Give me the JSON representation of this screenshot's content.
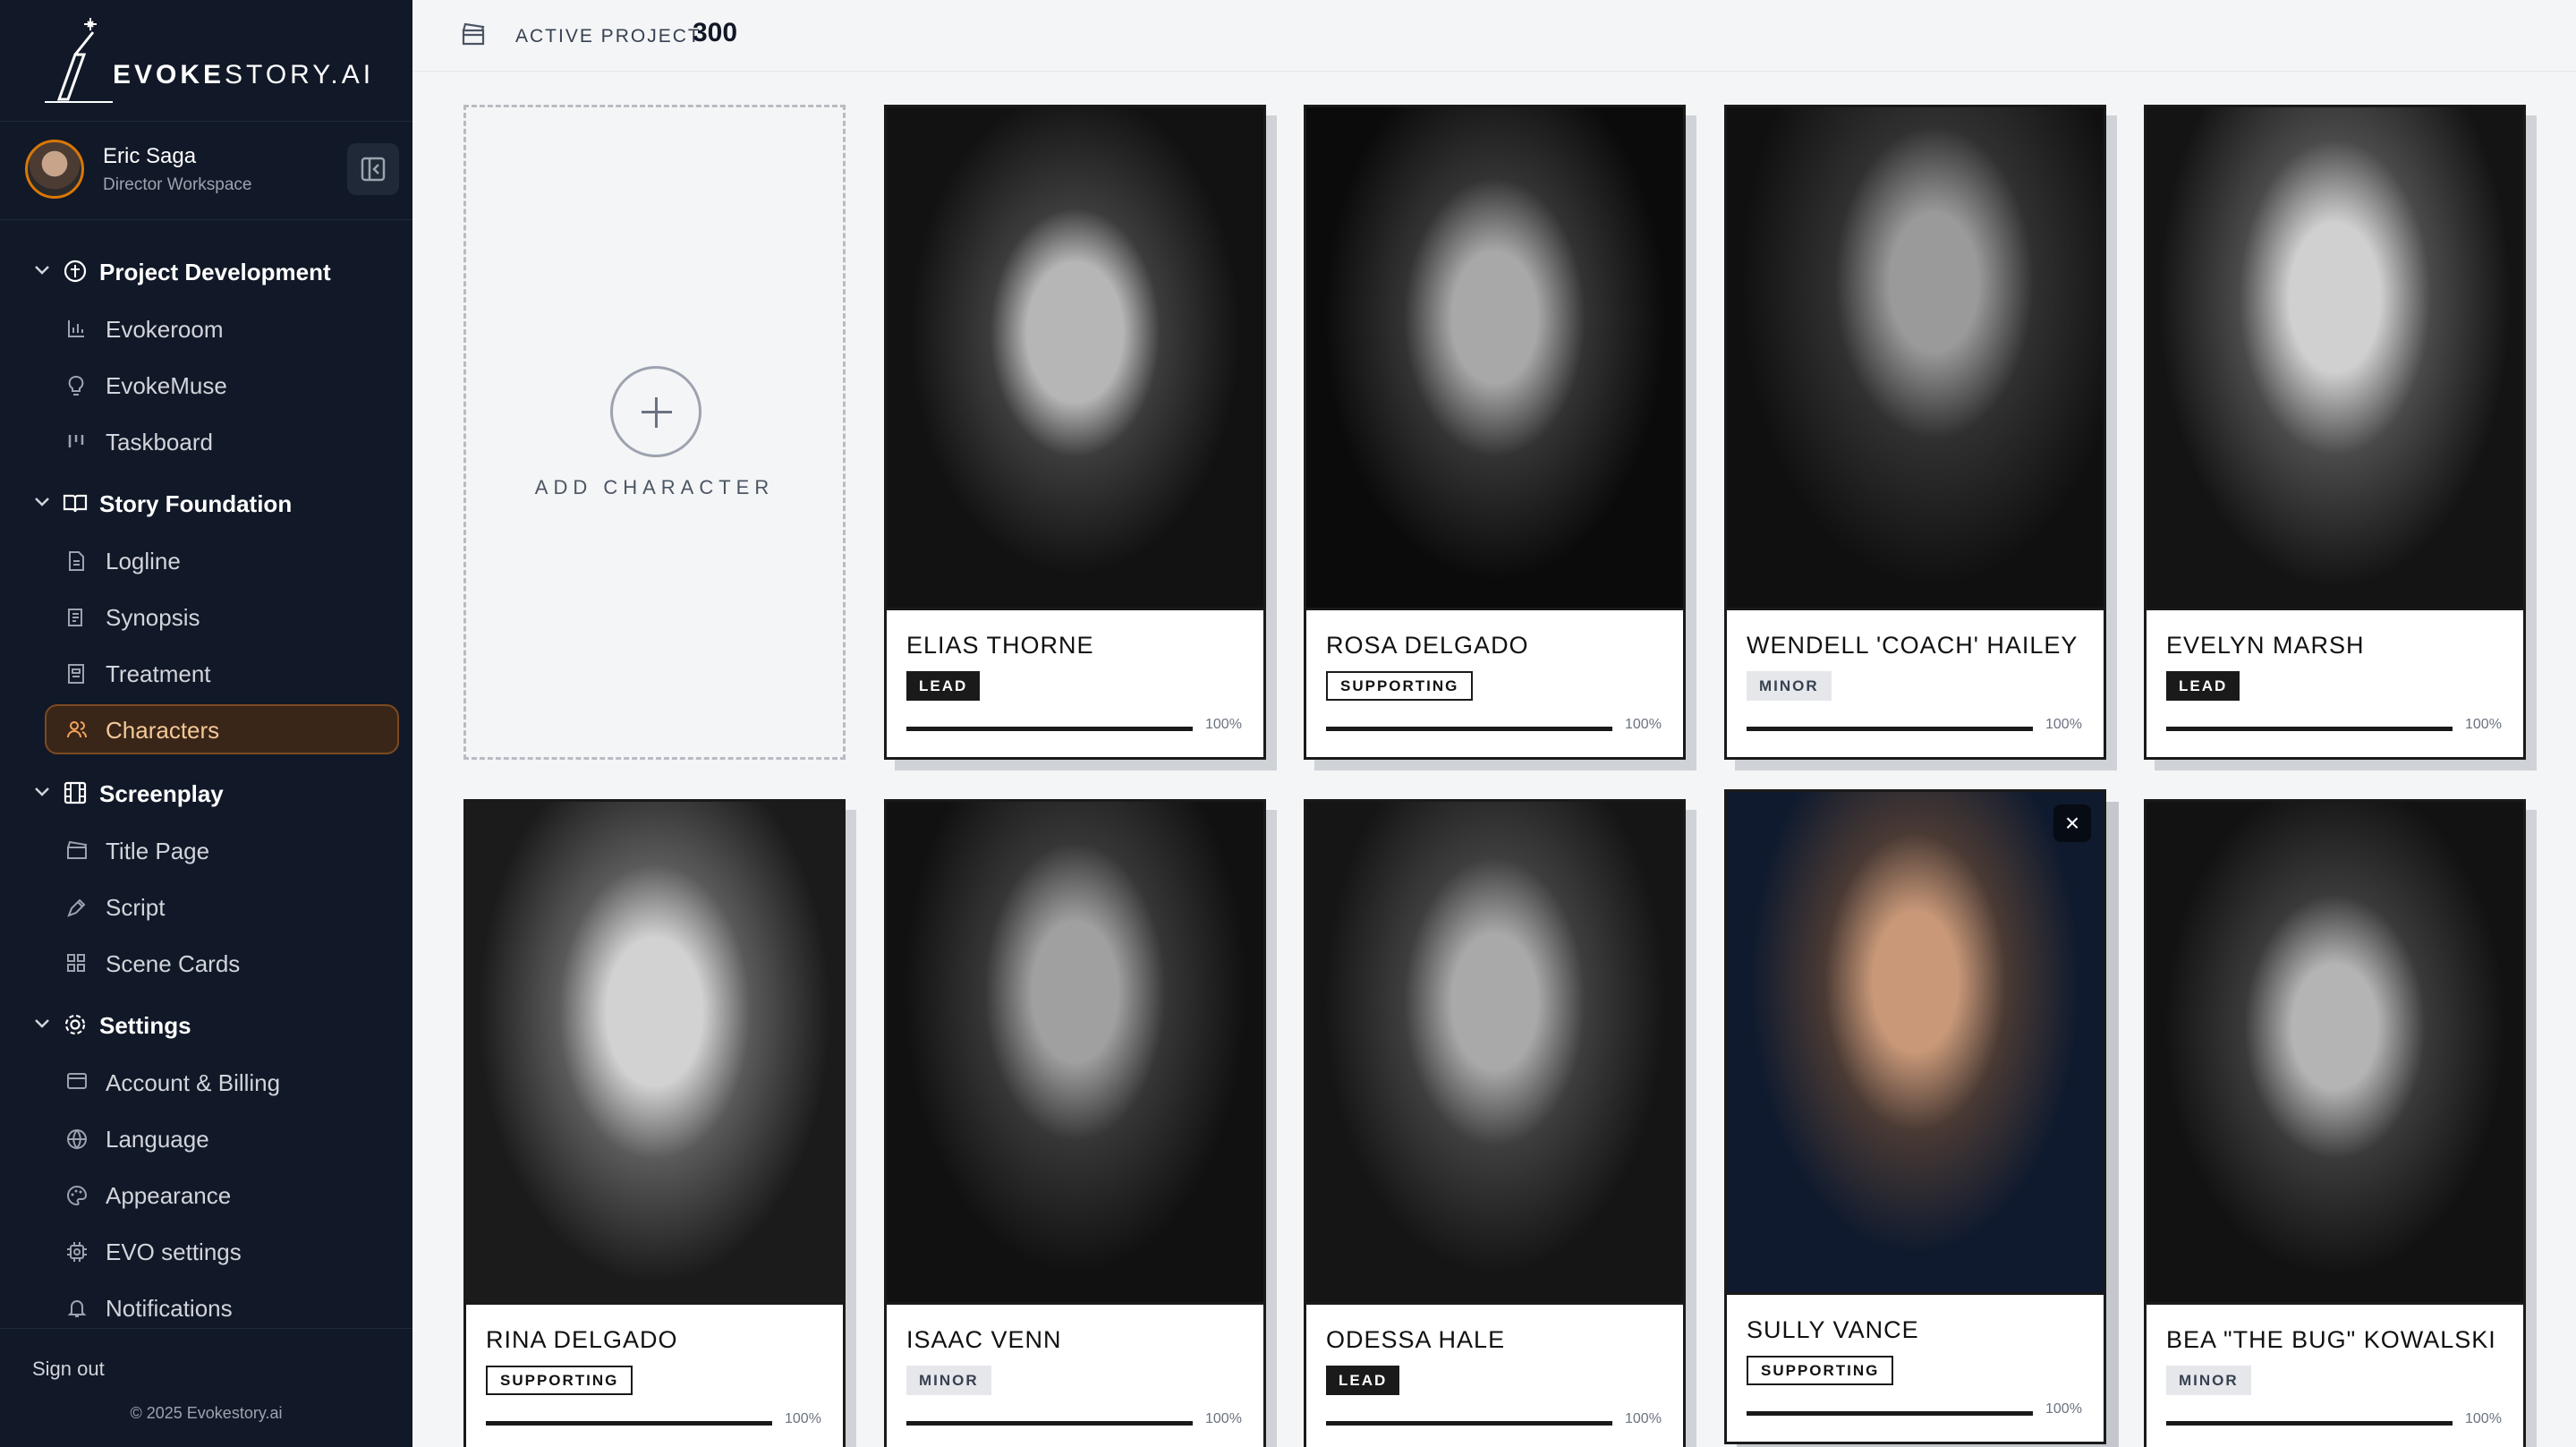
{
  "brand": {
    "logo_bold": "EVOKE",
    "logo_light": "STORY.AI"
  },
  "user": {
    "name": "Eric Saga",
    "role": "Director Workspace"
  },
  "nav": {
    "groups": [
      {
        "label": "Project Development",
        "items": [
          "Evokeroom",
          "EvokeMuse",
          "Taskboard"
        ]
      },
      {
        "label": "Story Foundation",
        "items": [
          "Logline",
          "Synopsis",
          "Treatment",
          "Characters"
        ]
      },
      {
        "label": "Screenplay",
        "items": [
          "Title Page",
          "Script",
          "Scene Cards"
        ]
      },
      {
        "label": "Settings",
        "items": [
          "Account & Billing",
          "Language",
          "Appearance",
          "EVO settings",
          "Notifications"
        ]
      }
    ],
    "active_item": "Characters"
  },
  "footer": {
    "signout": "Sign out",
    "copyright": "© 2025 Evokestory.ai"
  },
  "header": {
    "project_label": "ACTIVE PROJECT",
    "project_value": "300"
  },
  "add_card": {
    "label": "ADD CHARACTER"
  },
  "characters": [
    {
      "name": "ELIAS THORNE",
      "role": "LEAD",
      "progress": "100%"
    },
    {
      "name": "ROSA DELGADO",
      "role": "SUPPORTING",
      "progress": "100%"
    },
    {
      "name": "WENDELL 'COACH' HAILEY",
      "role": "MINOR",
      "progress": "100%"
    },
    {
      "name": "EVELYN MARSH",
      "role": "LEAD",
      "progress": "100%"
    },
    {
      "name": "RINA DELGADO",
      "role": "SUPPORTING",
      "progress": "100%"
    },
    {
      "name": "ISAAC VENN",
      "role": "MINOR",
      "progress": "100%"
    },
    {
      "name": "ODESSA HALE",
      "role": "LEAD",
      "progress": "100%"
    },
    {
      "name": "SULLY VANCE",
      "role": "SUPPORTING",
      "progress": "100%"
    },
    {
      "name": "BEA \"THE BUG\" KOWALSKI",
      "role": "MINOR",
      "progress": "100%"
    }
  ],
  "colors": {
    "sidebar_bg": "#111827",
    "accent": "#d97706",
    "active_item_bg": "#3a2618"
  }
}
